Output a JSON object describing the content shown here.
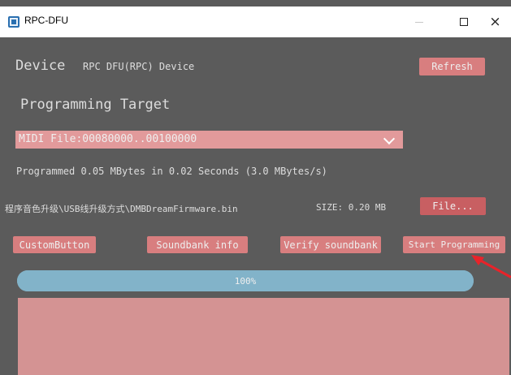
{
  "window": {
    "title": "RPC-DFU",
    "controls": {
      "minimize": "–",
      "close": "×"
    }
  },
  "device": {
    "label": "Device",
    "value": "RPC DFU(RPC) Device",
    "refresh_label": "Refresh"
  },
  "target": {
    "label": "Programming Target",
    "selected": "MIDI File:00080000..00100000"
  },
  "status": "Programmed 0.05 MBytes in 0.02 Seconds (3.0 MBytes/s)",
  "file": {
    "path": "程序音色升级\\USB线升级方式\\DMBDreamFirmware.bin",
    "size": "SIZE: 0.20 MB",
    "button_label": "File..."
  },
  "actions": {
    "custom": "CustomButton",
    "soundbank_info": "Soundbank info",
    "verify": "Verify soundbank",
    "start": "Start Programming"
  },
  "progress": {
    "text": "100%",
    "value": 1.0
  },
  "annotation_color": "#e8232a",
  "accent_color": "#d87e7f"
}
